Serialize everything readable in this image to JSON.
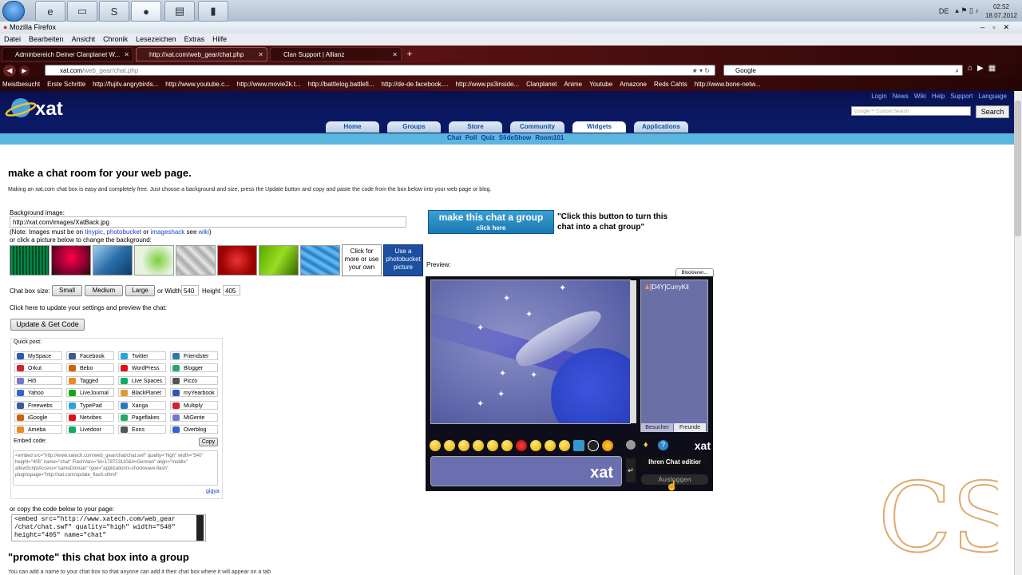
{
  "taskbar": {
    "apps": [
      "ie-icon",
      "explorer-icon",
      "skype-icon",
      "firefox-icon",
      "notes-icon",
      "camera-icon"
    ],
    "language": "DE",
    "time": "02:52",
    "date": "18.07.2012"
  },
  "browser": {
    "window_title": "Mozilla Firefox",
    "menu": [
      "Datei",
      "Bearbeiten",
      "Ansicht",
      "Chronik",
      "Lesezeichen",
      "Extras",
      "Hilfe"
    ],
    "tabs": [
      {
        "label": "Adminbereich Deiner Clanplanet W..."
      },
      {
        "label": "http://xat.com/web_gear/chat.php"
      },
      {
        "label": "Clan Support | Allianz"
      }
    ],
    "url_host": "xat.com",
    "url_path": "/web_gear/chat.php",
    "search_placeholder": "Google",
    "bookmarks": [
      "Meistbesucht",
      "Erste Schritte",
      "http://fujitv.angrybirds...",
      "http://www.youtube.c...",
      "http://www.movie2k.t...",
      "http://battlelog.battlefi...",
      "http://de-de.facebook....",
      "http://www.ps3inside...",
      "Clanplanet",
      "Anime",
      "Youtube",
      "Amazone",
      "Reds Cahts",
      "http://www.bone-netw..."
    ]
  },
  "site": {
    "logo": "xat",
    "top_links": [
      "Login",
      "News",
      "Wiki",
      "Help",
      "Support",
      "Language"
    ],
    "search_placeholder": "Google™ Custom Search",
    "search_button": "Search",
    "nav": [
      "Home",
      "Groups",
      "Store",
      "Community",
      "Widgets",
      "Applications"
    ],
    "subnav": [
      "Chat",
      "Poll",
      "Quiz",
      "SlideShow",
      "Room101"
    ]
  },
  "page": {
    "title": "make a chat room for your web page.",
    "intro": "Making an xat.com chat box is easy and completely free. Just choose a background and size, press the Update button and copy and paste the code from the box below into your web page or blog.",
    "bg_label": "Background image:",
    "bg_value": "http://xat.com/images/XatBack.jpg",
    "note_prefix": "(Note: Images must be on",
    "note_link1": "tinypic",
    "note_link2": "photobucket",
    "note_or": "or",
    "note_link3": "imageshack",
    "note_see": "see",
    "note_link4": "wiki",
    "note_end": ")",
    "or_click": "or click a picture below to change the background:",
    "custom_bg": "Click for more or use your own",
    "photobucket_bg": "Use a photobucket picture",
    "size_label": "Chat box size:",
    "size_small": "Small",
    "size_medium": "Medium",
    "size_large": "Large",
    "or_width": "or Width",
    "width": "540",
    "height_label": "Height",
    "height": "405",
    "update_hint": "Click here to update your settings and preview the chat:",
    "update_button": "Update & Get Code",
    "quick_post": "Quick post:",
    "quick_post_items": [
      [
        "MySpace",
        "Facebook",
        "Twitter",
        "Friendster"
      ],
      [
        "Orkut",
        "Bebo",
        "WordPress",
        "Blogger"
      ],
      [
        "Hi5",
        "Tagged",
        "Live Spaces",
        "Piczo"
      ],
      [
        "Yahoo",
        "LiveJournal",
        "BlackPlanet",
        "myYearbook"
      ],
      [
        "Freewebs",
        "TypePad",
        "Xanga",
        "Multiply"
      ],
      [
        "iGoogle",
        "Netvibes",
        "Pageflakes",
        "MiGente"
      ],
      [
        "Ameba",
        "Livedoor",
        "Eons",
        "Overblog"
      ]
    ],
    "embed_label": "Embed code:",
    "copy_button": "Copy",
    "embed_code": "<embed src=\"http://www.xatech.com/web_gear/chat/chat.swf\" quality=\"high\" width=\"540\" height=\"405\" name=\"chat\" FlashVars=\"id=178723110&rl=German\" align=\"middle\" allowScriptAccess=\"sameDomain\" type=\"application/x-shockwave-flash\" pluginspage=\"http://xat.com/update_flash.shtml\"",
    "gigya": "gigya",
    "copy_code_label": "or copy the code below to your page:",
    "code_line1": "<embed src=\"http://www.xatech.com/web_gear",
    "code_line2": "/chat/chat.swf\" quality=\"high\" width=\"540\"",
    "code_line3": "height=\"405\" name=\"chat\"",
    "promote_title": "\"promote\" this chat box into a group",
    "bottom_text": "You can add a name to your chat box so that anyone can add it their chat box where it will appear on a tab"
  },
  "group": {
    "button_main": "make this chat a group",
    "button_sub": "click here",
    "quote": "\"Click this button to turn this chat into a chat group\""
  },
  "preview": {
    "label": "Preview:",
    "block_button": "Blockieren...",
    "user": "[D4Y]CurryKil",
    "tab_visitors": "Besucher",
    "tab_friends": "Freunde",
    "edit_button": "Ihren Chat editier",
    "logout_button": "Ausloggen",
    "chat_logo": "xat"
  },
  "watermark": "CS"
}
